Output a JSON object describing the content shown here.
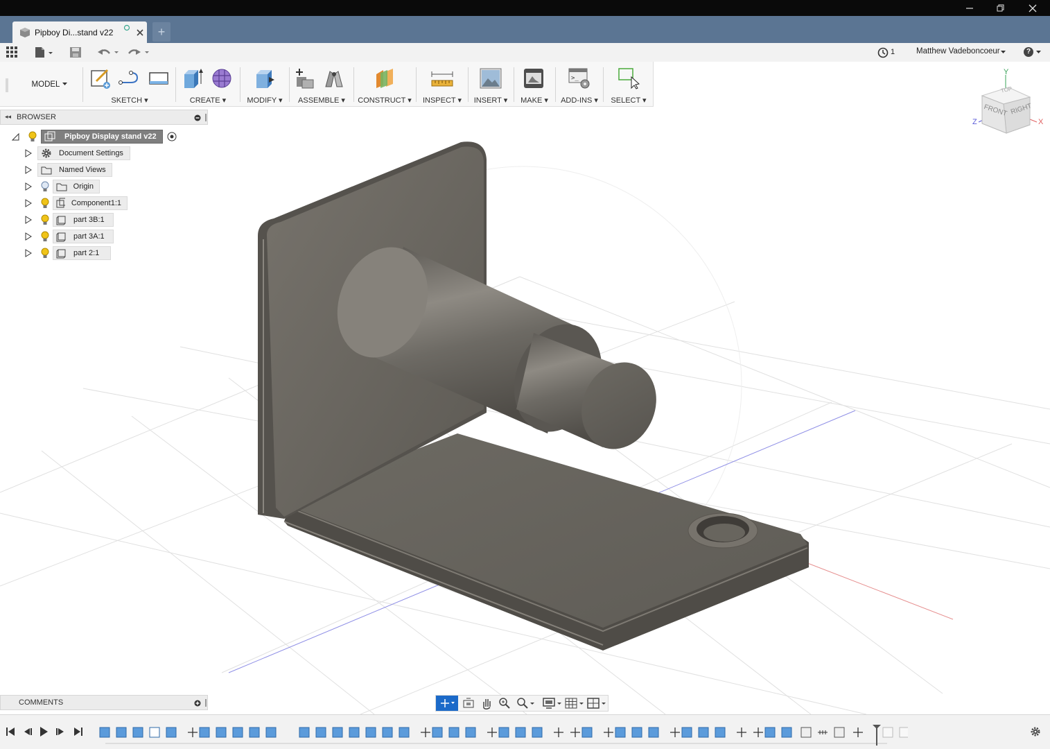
{
  "window": {
    "minimize_icon": "minimize-icon",
    "restore_icon": "restore-icon",
    "close_icon": "close-icon"
  },
  "tab": {
    "title": "Pipboy Di...stand v22",
    "new_tab": "+"
  },
  "qat": {
    "jobs_count": "1",
    "user": "Matthew Vadeboncoeur",
    "help": "?"
  },
  "ribbon": {
    "workspace": "MODEL",
    "groups": [
      "SKETCH",
      "CREATE",
      "MODIFY",
      "ASSEMBLE",
      "CONSTRUCT",
      "INSPECT",
      "INSERT",
      "MAKE",
      "ADD-INS",
      "SELECT"
    ]
  },
  "viewcube": {
    "front": "FRONT",
    "right": "RIGHT",
    "top": "TOP",
    "axis_x": "X",
    "axis_y": "Y",
    "axis_z": "Z"
  },
  "browser": {
    "title": "BROWSER",
    "root": "Pipboy Display stand v22",
    "items": [
      {
        "label": "Document Settings",
        "icon": "gear-icon"
      },
      {
        "label": "Named Views",
        "icon": "folder-icon"
      },
      {
        "label": "Origin",
        "icon": "folder-icon"
      },
      {
        "label": "Component1:1",
        "icon": "component-icon"
      },
      {
        "label": "part 3B:1",
        "icon": "body-icon"
      },
      {
        "label": "part 3A:1",
        "icon": "body-icon"
      },
      {
        "label": "part 2:1",
        "icon": "body-icon"
      }
    ]
  },
  "comments": {
    "title": "COMMENTS"
  },
  "colors": {
    "titlebar": "#0a0a0a",
    "tabbar": "#5b7593",
    "accent": "#1b6ac9",
    "part": "#6b6760"
  }
}
